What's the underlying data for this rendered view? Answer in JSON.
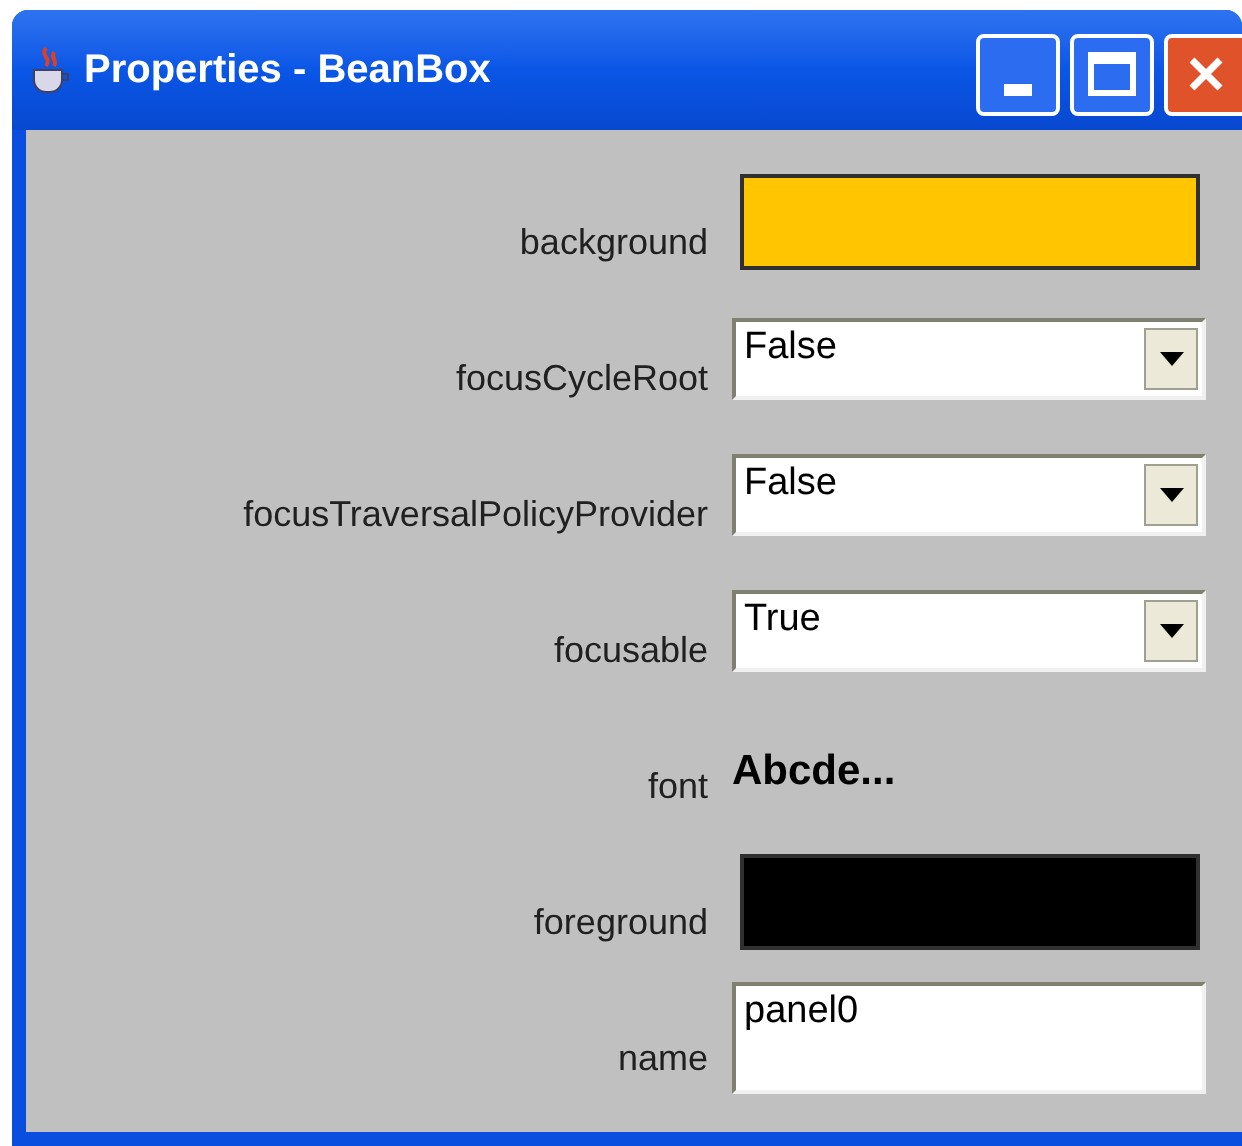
{
  "window": {
    "title": "Properties - BeanBox"
  },
  "properties": [
    {
      "label": "background",
      "kind": "color",
      "color": "#ffc600"
    },
    {
      "label": "focusCycleRoot",
      "kind": "choice",
      "value": "False"
    },
    {
      "label": "focusTraversalPolicyProvider",
      "kind": "choice",
      "value": "False"
    },
    {
      "label": "focusable",
      "kind": "choice",
      "value": "True"
    },
    {
      "label": "font",
      "kind": "font",
      "value": "Abcde..."
    },
    {
      "label": "foreground",
      "kind": "color",
      "color": "#000000"
    },
    {
      "label": "name",
      "kind": "text",
      "value": "panel0"
    }
  ]
}
